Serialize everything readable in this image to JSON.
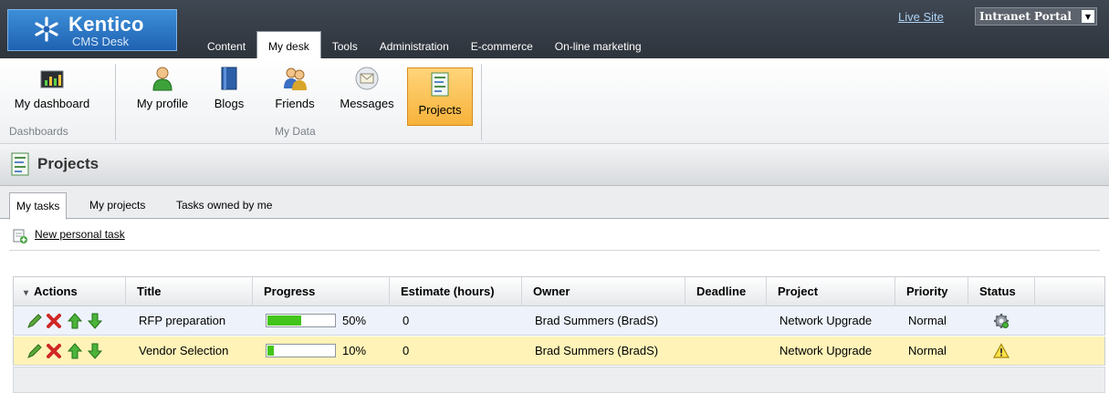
{
  "header": {
    "logo_brand": "Kentico",
    "logo_sub": "CMS Desk",
    "tabs": [
      {
        "label": "Content"
      },
      {
        "label": "My desk"
      },
      {
        "label": "Tools"
      },
      {
        "label": "Administration"
      },
      {
        "label": "E-commerce"
      },
      {
        "label": "On-line marketing"
      }
    ],
    "active_tab": "My desk",
    "live_site": "Live Site",
    "site_selector": "Intranet Portal"
  },
  "ribbon": {
    "groups": [
      {
        "name": "Dashboards",
        "buttons": [
          {
            "label": "My dashboard",
            "icon": "dashboard-chart-icon"
          }
        ]
      },
      {
        "name": "My Data",
        "buttons": [
          {
            "label": "My profile",
            "icon": "user-icon"
          },
          {
            "label": "Blogs",
            "icon": "book-icon"
          },
          {
            "label": "Friends",
            "icon": "friends-icon"
          },
          {
            "label": "Messages",
            "icon": "envelope-icon"
          },
          {
            "label": "Projects",
            "icon": "projects-icon"
          }
        ]
      }
    ],
    "active_button": "Projects"
  },
  "page": {
    "title": "Projects",
    "subtabs": [
      {
        "label": "My tasks"
      },
      {
        "label": "My projects"
      },
      {
        "label": "Tasks owned by me"
      }
    ],
    "active_subtab": "My tasks",
    "new_task_label": "New personal task"
  },
  "grid": {
    "columns": [
      "Actions",
      "Title",
      "Progress",
      "Estimate (hours)",
      "Owner",
      "Deadline",
      "Project",
      "Priority",
      "Status"
    ],
    "sort_glyph": "▾",
    "rows": [
      {
        "title": "RFP preparation",
        "progress": 50,
        "progress_text": "50%",
        "estimate": "0",
        "owner": "Brad Summers (BradS)",
        "deadline": "",
        "project": "Network Upgrade",
        "priority": "Normal",
        "status_icon": "gear-status-icon"
      },
      {
        "title": "Vendor Selection",
        "progress": 10,
        "progress_text": "10%",
        "estimate": "0",
        "owner": "Brad Summers (BradS)",
        "deadline": "",
        "project": "Network Upgrade",
        "priority": "Normal",
        "status_icon": "warning-icon"
      }
    ]
  },
  "colors": {
    "header_bg": "#3f4752",
    "logo_blue": "#2f7ccb",
    "ribbon_active": "#f7b23b",
    "progress_green": "#43c51b",
    "row_highlight": "#fff3b8",
    "row_alt": "#eef3fb"
  }
}
